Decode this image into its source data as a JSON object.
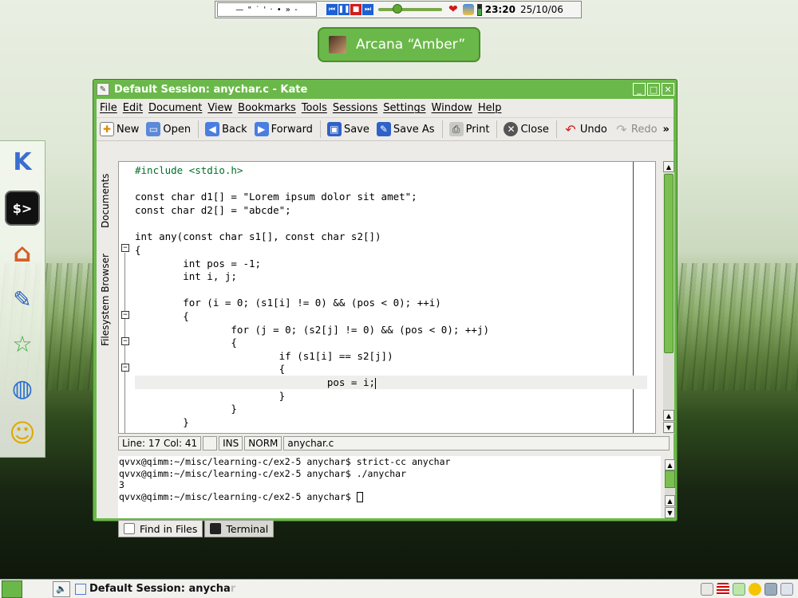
{
  "top_panel": {
    "pager": "— \" ˙ ' · • » -",
    "time": "23:20",
    "date": "25/10/06"
  },
  "osd": {
    "text": "Arcana “Amber”"
  },
  "launcher": {
    "items": [
      {
        "name": "kde-menu-icon"
      },
      {
        "name": "terminal-icon"
      },
      {
        "name": "home-icon"
      },
      {
        "name": "kate-editor-icon"
      },
      {
        "name": "favorites-icon"
      },
      {
        "name": "web-browser-icon"
      },
      {
        "name": "chat-icon"
      }
    ]
  },
  "window": {
    "title": "Default Session: anychar.c - Kate",
    "buttons": {
      "minimize": "_",
      "maximize": "□",
      "close": "✕"
    }
  },
  "menu": [
    "File",
    "Edit",
    "Document",
    "View",
    "Bookmarks",
    "Tools",
    "Sessions",
    "Settings",
    "Window",
    "Help"
  ],
  "toolbar": {
    "new": "New",
    "open": "Open",
    "back": "Back",
    "forward": "Forward",
    "save": "Save",
    "save_as": "Save As",
    "print": "Print",
    "close": "Close",
    "undo": "Undo",
    "redo": "Redo",
    "more": "»"
  },
  "side_tabs": {
    "documents": "Documents",
    "filesystem": "Filesystem Browser"
  },
  "code_lines": [
    "#include <stdio.h>",
    "",
    "const char d1[] = \"Lorem ipsum dolor sit amet\";",
    "const char d2[] = \"abcde\";",
    "",
    "int any(const char s1[], const char s2[])",
    "{",
    "        int pos = -1;",
    "        int i, j;",
    "",
    "        for (i = 0; (s1[i] != 0) && (pos < 0); ++i)",
    "        {",
    "                for (j = 0; (s2[j] != 0) && (pos < 0); ++j)",
    "                {",
    "                        if (s1[i] == s2[j])",
    "                        {",
    "                                pos = i;",
    "                        }",
    "                }",
    "        }"
  ],
  "status": {
    "position": "Line: 17 Col: 41",
    "ins": "INS",
    "norm": "NORM",
    "file": "anychar.c"
  },
  "terminal": {
    "lines": [
      "qvvx@qimm:~/misc/learning-c/ex2-5 anychar$ strict-cc anychar",
      "qvvx@qimm:~/misc/learning-c/ex2-5 anychar$ ./anychar",
      "3",
      "qvvx@qimm:~/misc/learning-c/ex2-5 anychar$ "
    ]
  },
  "bottom_tabs": {
    "find": "Find in Files",
    "terminal": "Terminal"
  },
  "taskbar": {
    "task": "Default Session: anycha",
    "task_fade": "r"
  }
}
